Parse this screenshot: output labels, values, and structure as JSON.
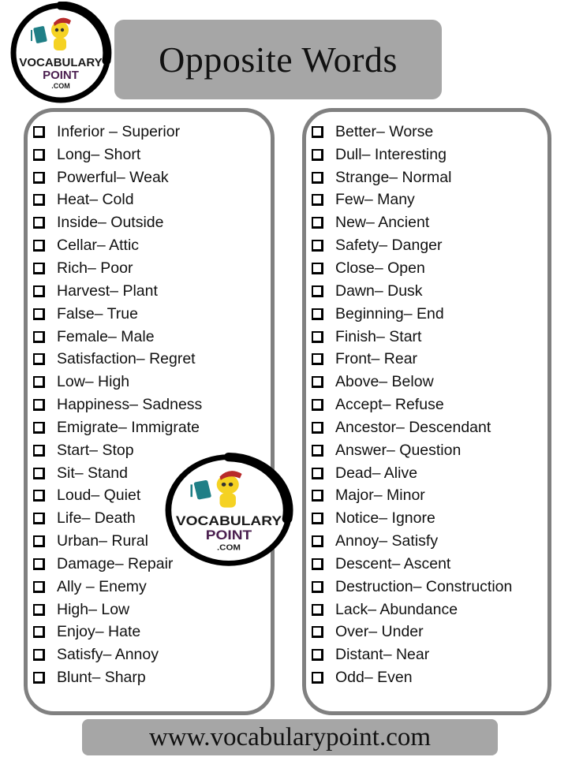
{
  "title": "Opposite Words",
  "logo": {
    "line1": "VOCABULARY",
    "line2": "POINT",
    "line3": ".COM",
    "colors": {
      "line1": "#1a1a1a",
      "line2": "#4a1f4f",
      "line3": "#1a1a1a",
      "ring": "#000000"
    }
  },
  "left_column": [
    "Inferior – Superior",
    "Long– Short",
    "Powerful– Weak",
    "Heat– Cold",
    "Inside– Outside",
    "Cellar– Attic",
    "Rich– Poor",
    "Harvest– Plant",
    "False– True",
    "Female– Male",
    "Satisfaction– Regret",
    "Low– High",
    "Happiness– Sadness",
    "Emigrate– Immigrate",
    "Start– Stop",
    "Sit– Stand",
    "Loud– Quiet",
    "Life– Death",
    "Urban– Rural",
    "Damage– Repair",
    "Ally – Enemy",
    "High– Low",
    "Enjoy– Hate",
    "Satisfy– Annoy",
    "Blunt– Sharp"
  ],
  "right_column": [
    "Better– Worse",
    "Dull– Interesting",
    "Strange– Normal",
    "Few– Many",
    "New– Ancient",
    "Safety– Danger",
    "Close– Open",
    "Dawn– Dusk",
    "Beginning– End",
    "Finish– Start",
    "Front– Rear",
    "Above– Below",
    "Accept– Refuse",
    "Ancestor– Descendant",
    "Answer– Question",
    "Dead– Alive",
    "Major– Minor",
    "Notice– Ignore",
    "Annoy– Satisfy",
    "Descent– Ascent",
    "Destruction– Construction",
    "Lack– Abundance",
    "Over– Under",
    "Distant– Near",
    "Odd– Even"
  ],
  "footer": "www.vocabularypoint.com",
  "colors": {
    "banner_bg": "#a6a6a6",
    "panel_border": "#808080"
  }
}
